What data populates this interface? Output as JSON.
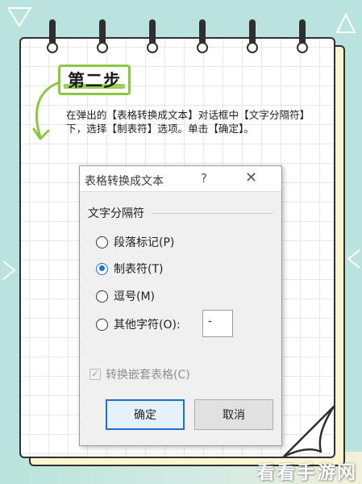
{
  "step": {
    "label": "第二步"
  },
  "instruction": {
    "text": "在弹出的【表格转换成文本】对话框中【文字分隔符】下，选择【制表符】选项。单击【确定】。"
  },
  "dialog": {
    "title": "表格转换成文本",
    "help": "?",
    "close": "✕",
    "group_label": "文字分隔符",
    "options": [
      {
        "label": "段落标记(P)",
        "checked": false
      },
      {
        "label": "制表符(T)",
        "checked": true
      },
      {
        "label": "逗号(M)",
        "checked": false
      },
      {
        "label": "其他字符(O):",
        "checked": false
      }
    ],
    "other_value": "-",
    "nested_checkbox": {
      "label": "转换嵌套表格(C)",
      "checkmark": "✓",
      "checked": true,
      "disabled": true
    },
    "ok_label": "确定",
    "cancel_label": "取消"
  },
  "watermark": {
    "text": "看看手游网"
  },
  "colors": {
    "accent_green": "#8dc63f",
    "background": "#b9e3dc",
    "selection_blue": "#1f6fd1"
  }
}
